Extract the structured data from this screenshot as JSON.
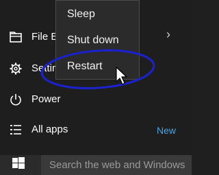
{
  "start_menu": {
    "items": [
      {
        "label": "File Explorer",
        "icon": "folder-icon"
      },
      {
        "label": "Settings",
        "icon": "gear-icon"
      },
      {
        "label": "Power",
        "icon": "power-icon"
      },
      {
        "label": "All apps",
        "icon": "list-icon"
      }
    ],
    "new_badge": "New"
  },
  "power_menu": {
    "items": [
      "Sleep",
      "Shut down",
      "Restart"
    ],
    "highlighted": "Restart"
  },
  "taskbar": {
    "search_placeholder": "Search the web and Windows"
  },
  "annotation": {
    "ellipse_color": "#1a22c8"
  },
  "colors": {
    "background": "#1e1e1e",
    "popup": "#2b2b2b",
    "accent": "#4aa3e8"
  }
}
